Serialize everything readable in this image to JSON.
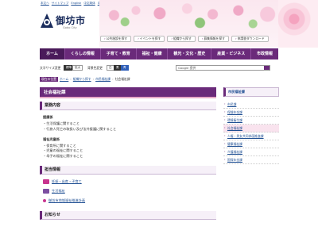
{
  "utility": {
    "links": [
      "本文へ",
      "サイトマップ",
      "English",
      "中文简体",
      "中文繁體",
      "한국어"
    ]
  },
  "logo": {
    "name": "御坊市",
    "en": "Gobo City"
  },
  "quicklinks": [
    "公共施設を探す",
    "イベントを探す",
    "組織から探す",
    "募集情報を探す",
    "申請書ダウンロード"
  ],
  "gnav": [
    "ホーム",
    "くらしの情報",
    "子育て・教育",
    "福祉・健康",
    "観光・文化・歴史",
    "産業・ビジネス",
    "市政情報"
  ],
  "toolbar": {
    "font_size_label": "文字サイズ変更",
    "font_std": "標準",
    "font_large": "拡大",
    "bg_label": "背景色変更",
    "bg_white": "白",
    "bg_black": "黒",
    "bg_blue": "青",
    "search_value": "Google 提供"
  },
  "breadcrumb": {
    "here": "現在の位置",
    "items": [
      "ホーム",
      "組織から探す",
      "市民福祉課"
    ],
    "current": "社会福祉課"
  },
  "main": {
    "page_title": "社会福祉課",
    "duties_title": "業務内容",
    "sub1": "援護係",
    "items1": [
      "生活保護に関すること",
      "行旅人死亡の取扱い及び法外援護に関すること"
    ],
    "sub2": "福祉児童係",
    "items2": [
      "保育所に関すること",
      "児童の福祉に関すること",
      "母子の福祉に関すること"
    ],
    "contact_title": "担当情報",
    "contact_items": [
      "妊娠・出産・子育て",
      "生活福祉",
      "御坊市地域福祉推進計画"
    ],
    "notice_title": "お知らせ"
  },
  "side": {
    "title": "市民福祉課",
    "items": [
      "市民課",
      "保険年金課",
      "環境衛生課",
      "社会福祉課",
      "人権・男女共同参画推進課",
      "健康福祉課",
      "介護福祉課",
      "国保年金課"
    ]
  },
  "colors": {
    "nav": "#6a2a7a",
    "accent_pink": "#c8348f",
    "link": "#1f4f93"
  }
}
